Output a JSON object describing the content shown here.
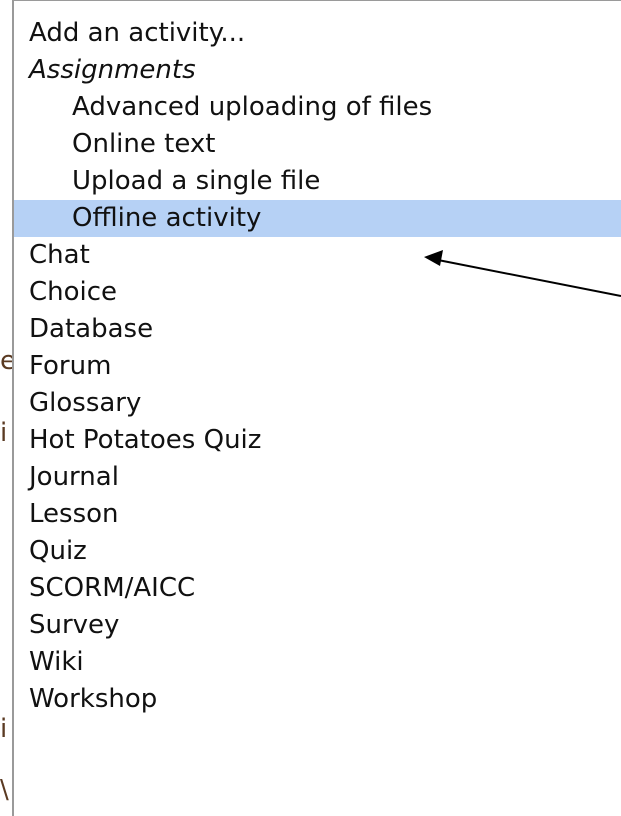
{
  "menu": {
    "placeholder": "Add an activity...",
    "group_label": "Assignments",
    "sub_items": [
      "Advanced uploading of files",
      "Online text",
      "Upload a single file",
      "Offline activity"
    ],
    "items": [
      "Chat",
      "Choice",
      "Database",
      "Forum",
      "Glossary",
      "Hot Potatoes Quiz",
      "Journal",
      "Lesson",
      "Quiz",
      "SCORM/AICC",
      "Survey",
      "Wiki",
      "Workshop"
    ],
    "selected": "Offline activity"
  },
  "background_fragments": [
    "e",
    "i",
    "i",
    "\\"
  ],
  "colors": {
    "selection": "#b6d1f5",
    "menu_border": "#9a9a9a",
    "text": "#111111",
    "arrow": "#000000"
  }
}
